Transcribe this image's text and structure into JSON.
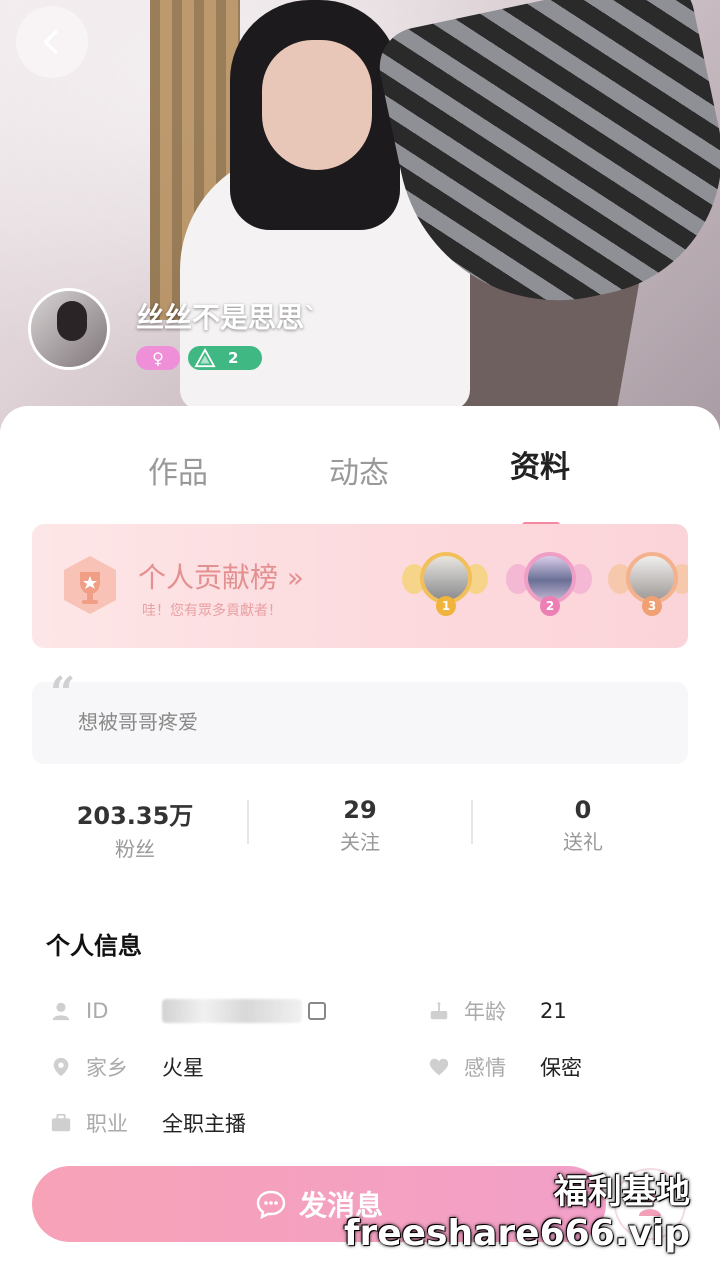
{
  "profile": {
    "username": "丝丝不是思思`",
    "gender_symbol": "♀",
    "level": "2"
  },
  "tabs": [
    "作品",
    "动态",
    "资料"
  ],
  "active_tab": "资料",
  "contribution": {
    "title": "个人贡献榜",
    "arrow": "»",
    "subtitle": "哇！您有眾多貢獻者！",
    "ranks": [
      "1",
      "2",
      "3"
    ]
  },
  "bio": {
    "text": "想被哥哥疼爱"
  },
  "stats": [
    {
      "value": "203.35万",
      "label": "粉丝"
    },
    {
      "value": "29",
      "label": "关注"
    },
    {
      "value": "0",
      "label": "送礼"
    }
  ],
  "info": {
    "title": "个人信息",
    "id_label": "ID",
    "age_label": "年龄",
    "age_value": "21",
    "hometown_label": "家乡",
    "hometown_value": "火星",
    "relationship_label": "感情",
    "relationship_value": "保密",
    "job_label": "职业",
    "job_value": "全职主播"
  },
  "actions": {
    "message_label": "发消息"
  },
  "watermark": {
    "line1": "福利基地",
    "line2": "freeshare666.vip"
  },
  "colors": {
    "accent_pink": "#f38aa2",
    "level_green": "#3fb884",
    "gender_pink": "#ee8fd8"
  }
}
